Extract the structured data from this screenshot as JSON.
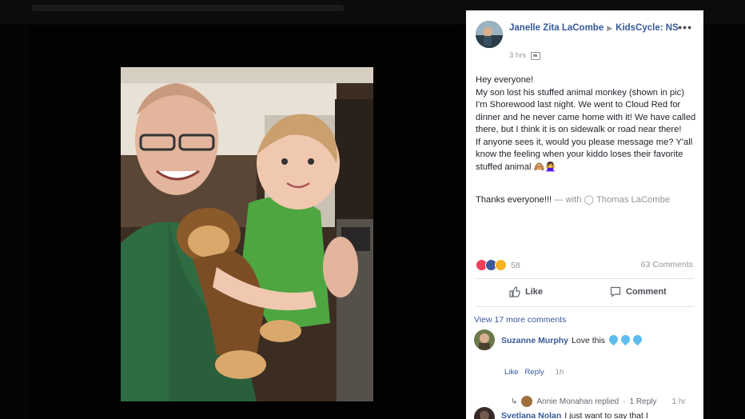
{
  "post": {
    "author": "Janelle Zita LaCombe",
    "group": "KidsCycle: NS",
    "time": "3 hrs",
    "more_icon": "•••",
    "body": [
      "Hey everyone!",
      "My son lost his stuffed animal monkey (shown in pic) I'm Shorewood last night. We went to Cloud Red for dinner and he never came home with it! We have called there, but I think it is on sidewalk or road near there!",
      "If anyone sees it, would you please message me? Y'all know the feeling when your kiddo loses their favorite stuffed animal 🙈🙅‍♀️"
    ],
    "thanks": "Thanks everyone!!!",
    "with_label": "— with",
    "tagged": "Thomas LaCombe",
    "reaction_count": "58",
    "comments_count": "63 Comments",
    "like_label": "Like",
    "comment_label": "Comment",
    "view_more": "View 17 more comments"
  },
  "comments": [
    {
      "name": "Suzanne Murphy",
      "text": "Love this",
      "actions": {
        "like": "Like",
        "reply": "Reply",
        "time": "1h"
      },
      "reply_summary": {
        "who": "Annie Monahan replied",
        "sep": "·",
        "count": "1 Reply",
        "ago": "1 hr"
      }
    },
    {
      "name": "Svetlana Nolan",
      "text": "I just want to say that I"
    }
  ],
  "colors": {
    "link": "#365899",
    "muted": "#90949c",
    "heart": "#5dbcf0"
  }
}
